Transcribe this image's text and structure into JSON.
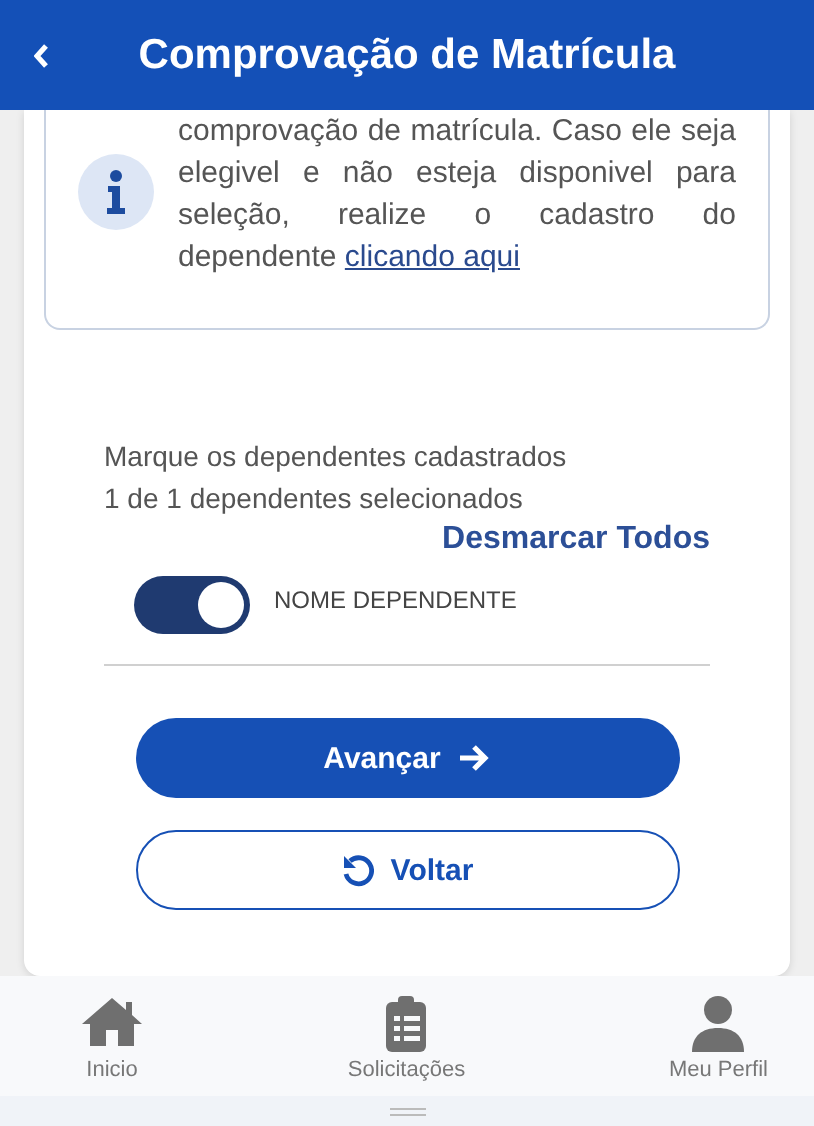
{
  "header": {
    "title": "Comprovação de Matrícula"
  },
  "info": {
    "text": "comprovação de matrícula. Caso ele seja elegivel e não esteja disponivel para seleção, realize o cadastro do dependente",
    "link": "clicando aqui"
  },
  "selection": {
    "instruction": "Marque os dependentes cadastrados",
    "count": "1 de 1 dependentes selecionados",
    "toggle_all": "Desmarcar Todos"
  },
  "dependents": [
    {
      "name": "NOME DEPENDENTE",
      "on": true
    }
  ],
  "buttons": [
    {
      "kind": "primary",
      "label": "Avançar"
    },
    {
      "kind": "secondary",
      "label": "Voltar"
    }
  ],
  "nav": [
    {
      "label": "Inicio"
    },
    {
      "label": "Solicitações"
    },
    {
      "label": "Meu Perfil"
    }
  ]
}
